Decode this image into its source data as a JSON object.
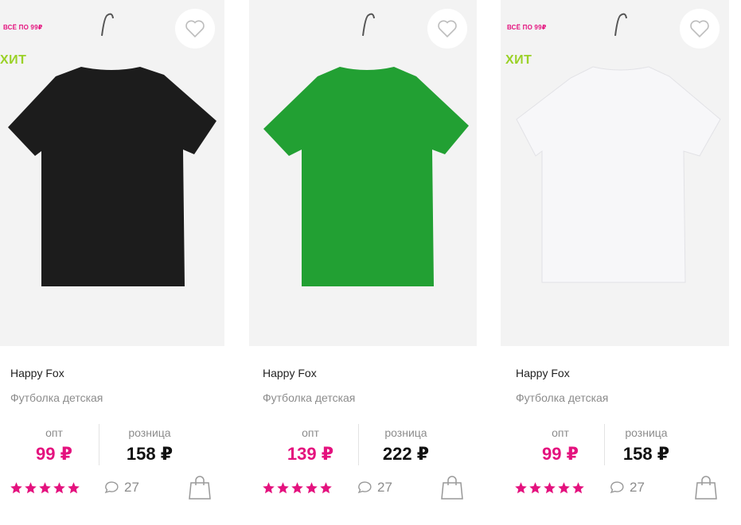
{
  "products": [
    {
      "brand": "Happy Fox",
      "name": "Футболка детская",
      "badge_sale": "ВСЁ ПО 99₽",
      "badge_hit": "ХИТ",
      "shirt_color": "#1c1c1c",
      "opt_label": "опт",
      "opt_price": "99 ₽",
      "retail_label": "розница",
      "retail_price": "158 ₽",
      "rating": 5,
      "comments": "27"
    },
    {
      "brand": "Happy Fox",
      "name": "Футболка детская",
      "badge_sale": "",
      "badge_hit": "",
      "shirt_color": "#22a033",
      "opt_label": "опт",
      "opt_price": "139 ₽",
      "retail_label": "розница",
      "retail_price": "222 ₽",
      "rating": 5,
      "comments": "27"
    },
    {
      "brand": "Happy Fox",
      "name": "Футболка детская",
      "badge_sale": "ВСЁ ПО 99₽",
      "badge_hit": "ХИТ",
      "shirt_color": "#f7f7f9",
      "opt_label": "опт",
      "opt_price": "99 ₽",
      "retail_label": "розница",
      "retail_price": "158 ₽",
      "rating": 5,
      "comments": "27"
    }
  ],
  "icons": {
    "favorite": "heart-icon",
    "rating": "star-icon",
    "comments": "comment-bubble-icon",
    "cart": "shopping-bag-icon"
  },
  "colors": {
    "accent": "#e4127e",
    "hit": "#9ad126",
    "muted": "#8c8c8c"
  }
}
